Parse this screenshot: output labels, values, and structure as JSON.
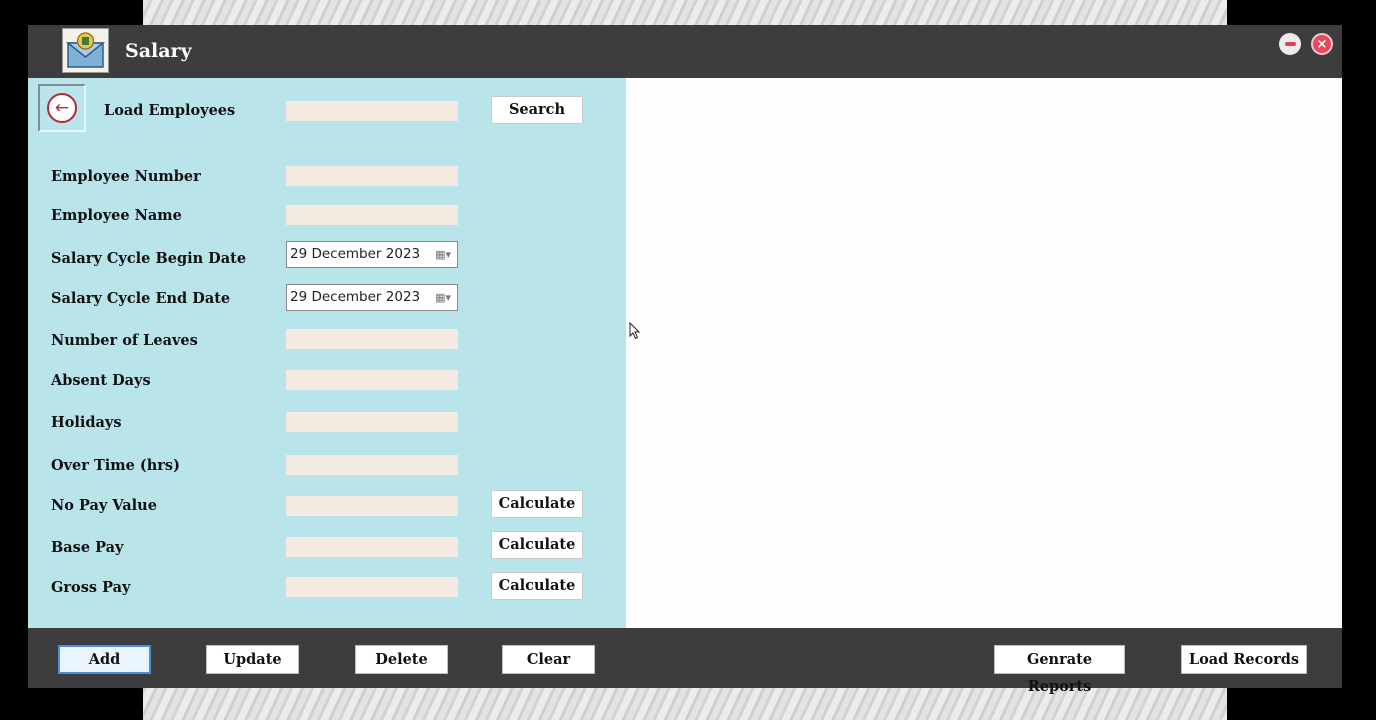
{
  "window": {
    "title": "Salary",
    "app_icon": "envelope-money-icon",
    "minimize_icon": "minimize-icon",
    "close_icon": "close-icon",
    "close_glyph": "×"
  },
  "form": {
    "back_icon": "back-arrow-icon",
    "back_glyph": "←",
    "load_employees_label": "Load Employees",
    "search_value": "",
    "search_button": "Search",
    "employee_number_label": "Employee Number",
    "employee_number_value": "",
    "employee_name_label": "Employee Name",
    "employee_name_value": "",
    "cycle_begin_label": "Salary Cycle Begin Date",
    "cycle_begin_value": "29 December 2023",
    "cycle_end_label": "Salary Cycle End Date",
    "cycle_end_value": "29 December 2023",
    "calendar_glyph": "▦▾",
    "leaves_label": "Number of Leaves",
    "leaves_value": "",
    "absent_label": "Absent Days",
    "absent_value": "",
    "holidays_label": "Holidays",
    "holidays_value": "",
    "overtime_label": "Over Time (hrs)",
    "overtime_value": "",
    "no_pay_label": "No Pay Value",
    "no_pay_value": "",
    "base_pay_label": "Base Pay",
    "base_pay_value": "",
    "gross_pay_label": "Gross Pay",
    "gross_pay_value": "",
    "calculate_label": "Calculate"
  },
  "toolbar": {
    "add": "Add",
    "update": "Update",
    "delete": "Delete",
    "clear": "Clear",
    "generate_reports": "Genrate Reports",
    "load_records": "Load Records"
  },
  "colors": {
    "titlebar": "#3d3d3d",
    "form_panel": "#b8e4ea",
    "field_bg": "#f3ebe2",
    "close_button": "#e84a5a",
    "active_button_border": "#4a90d9"
  }
}
